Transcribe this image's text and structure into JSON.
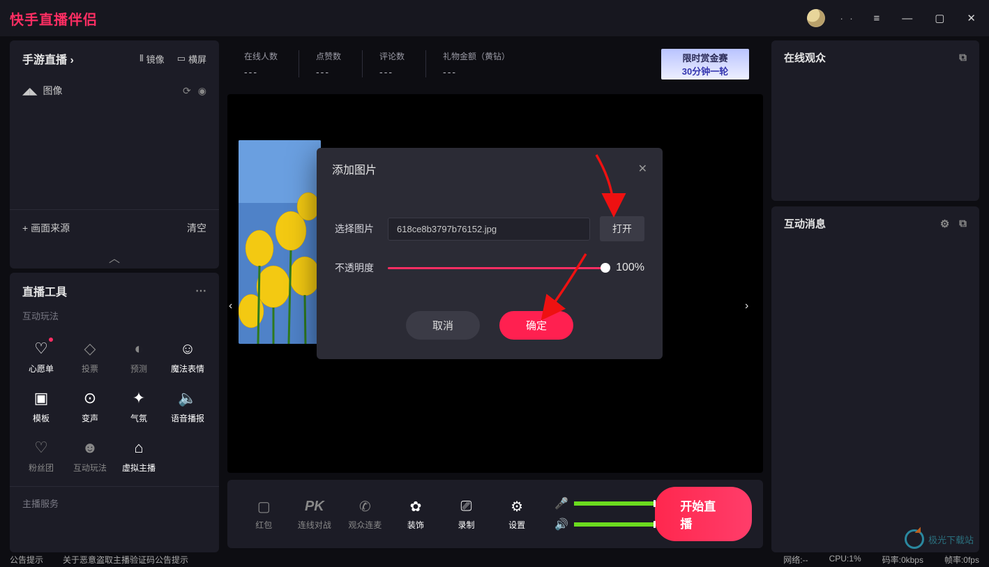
{
  "app": {
    "title": "快手直播伴侣"
  },
  "titlebar": {
    "ellipsis": "∙ ∙"
  },
  "sidebar_source": {
    "title": "手游直播 ›",
    "mirror": "镜像",
    "landscape": "横屏",
    "item_image": "图像",
    "add_source": "+ 画面来源",
    "clear": "清空"
  },
  "tools": {
    "title": "直播工具",
    "section_interactive": "互动玩法",
    "wish": "心愿单",
    "vote": "投票",
    "predict": "预测",
    "magic": "魔法表情",
    "template": "模板",
    "voice_change": "变声",
    "atmosphere": "气氛",
    "tts": "语音播报",
    "fans": "粉丝团",
    "interactive": "互动玩法",
    "vhost": "虚拟主播",
    "section_host": "主播服务"
  },
  "stats": {
    "online": {
      "label": "在线人数",
      "value": "---"
    },
    "likes": {
      "label": "点赞数",
      "value": "---"
    },
    "comments": {
      "label": "评论数",
      "value": "---"
    },
    "gifts": {
      "label": "礼物金额（黄钻）",
      "value": "---"
    }
  },
  "promo": {
    "line1": "限时赏金赛",
    "line2": "30分钟一轮"
  },
  "bottombar": {
    "redpack": "红包",
    "pk": "连线对战",
    "audience": "观众连麦",
    "decor": "装饰",
    "record": "录制",
    "settings": "设置",
    "pk_icon": "PK"
  },
  "start_button": "开始直播",
  "right": {
    "audience_title": "在线观众",
    "msg_title": "互动消息"
  },
  "dialog": {
    "title": "添加图片",
    "select_label": "选择图片",
    "file_name": "618ce8b3797b76152.jpg",
    "open": "打开",
    "opacity_label": "不透明度",
    "opacity_value": "100%",
    "cancel": "取消",
    "ok": "确定"
  },
  "statusbar": {
    "notice_label": "公告提示",
    "notice_text": "关于恶意盗取主播验证码公告提示",
    "network": "网络:--",
    "cpu": "CPU:1%",
    "bitrate": "码率:0kbps",
    "fps": "帧率:0fps"
  },
  "watermark": "极光下载站"
}
